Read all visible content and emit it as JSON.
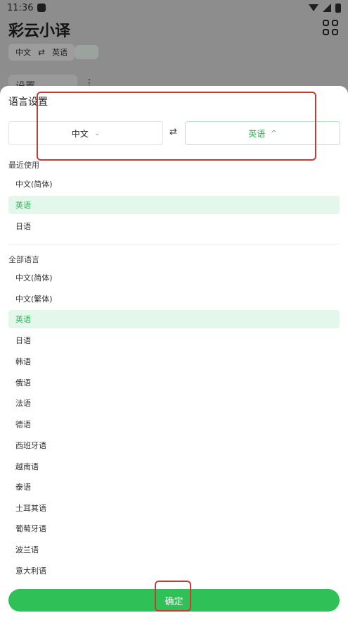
{
  "status": {
    "time": "11:36"
  },
  "app": {
    "title": "彩云小译",
    "lang_chip": {
      "source": "中文",
      "target": "英语"
    },
    "input_peek": "设置"
  },
  "sheet": {
    "title": "语言设置",
    "source_language": "中文",
    "target_language": "英语",
    "recent_label": "最近使用",
    "recent_items": [
      {
        "label": "中文(简体)",
        "selected": false
      },
      {
        "label": "英语",
        "selected": true
      },
      {
        "label": "日语",
        "selected": false
      }
    ],
    "all_label": "全部语言",
    "all_items": [
      {
        "label": "中文(简体)",
        "selected": false
      },
      {
        "label": "中文(繁体)",
        "selected": false
      },
      {
        "label": "英语",
        "selected": true
      },
      {
        "label": "日语",
        "selected": false
      },
      {
        "label": "韩语",
        "selected": false
      },
      {
        "label": "俄语",
        "selected": false
      },
      {
        "label": "法语",
        "selected": false
      },
      {
        "label": "德语",
        "selected": false
      },
      {
        "label": "西班牙语",
        "selected": false
      },
      {
        "label": "越南语",
        "selected": false
      },
      {
        "label": "泰语",
        "selected": false
      },
      {
        "label": "土耳其语",
        "selected": false
      },
      {
        "label": "葡萄牙语",
        "selected": false
      },
      {
        "label": "波兰语",
        "selected": false
      },
      {
        "label": "意大利语",
        "selected": false
      }
    ],
    "confirm_label": "确定"
  },
  "colors": {
    "accent": "#2fc157",
    "selected_bg": "#e3f7ea",
    "annotation": "#c83b2f"
  }
}
